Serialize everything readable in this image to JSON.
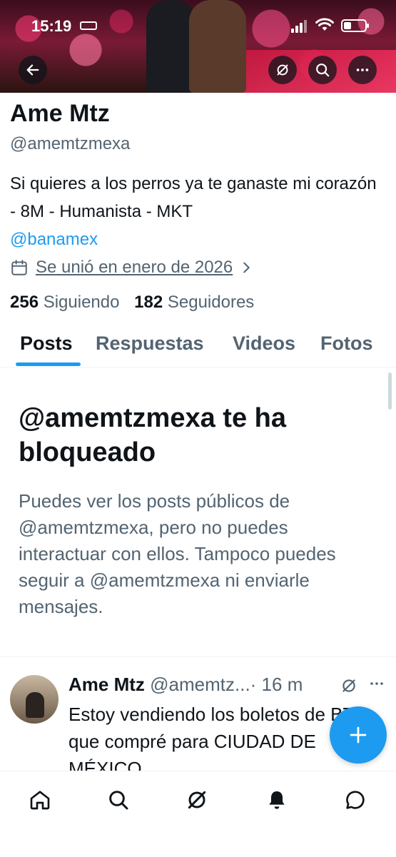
{
  "status_bar": {
    "time": "15:19"
  },
  "profile": {
    "name": "Ame Mtz",
    "handle": "@amemtzmexa",
    "bio": "Si quieres a los perros ya te ganaste mi corazón - 8M - Humanista - MKT",
    "bio_mention": "@banamex",
    "joined": "Se unió en enero de 2026",
    "following_count": "256",
    "following_label": "Siguiendo",
    "followers_count": "182",
    "followers_label": "Seguidores"
  },
  "tabs": [
    {
      "label": "Posts"
    },
    {
      "label": "Respuestas"
    },
    {
      "label": "Videos"
    },
    {
      "label": "Fotos"
    }
  ],
  "blocked": {
    "title": "@amemtzmexa te ha bloqueado",
    "description": "Puedes ver los posts públicos de @amemtzmexa, pero no puedes interactuar con ellos. Tampoco puedes seguir a @amemtzmexa ni enviarle mensajes."
  },
  "tweet": {
    "name": "Ame Mtz",
    "handle": "@amemtz...",
    "time": "· 16 m",
    "text": "Estoy vendiendo los boletos de BTS que compré para CIUDAD DE MÉXICO"
  },
  "icons": {
    "back": "arrow-left-icon",
    "grok": "grok-icon",
    "search": "search-icon",
    "more": "more-icon",
    "calendar": "calendar-icon",
    "chevron": "chevron-right-icon",
    "compose": "plus-icon",
    "home": "home-icon",
    "explore": "search-icon",
    "grok_tab": "grok-icon",
    "notifications": "bell-icon",
    "messages": "chat-icon"
  },
  "colors": {
    "accent": "#1d9bf0",
    "text": "#0f1419",
    "muted": "#536471"
  }
}
